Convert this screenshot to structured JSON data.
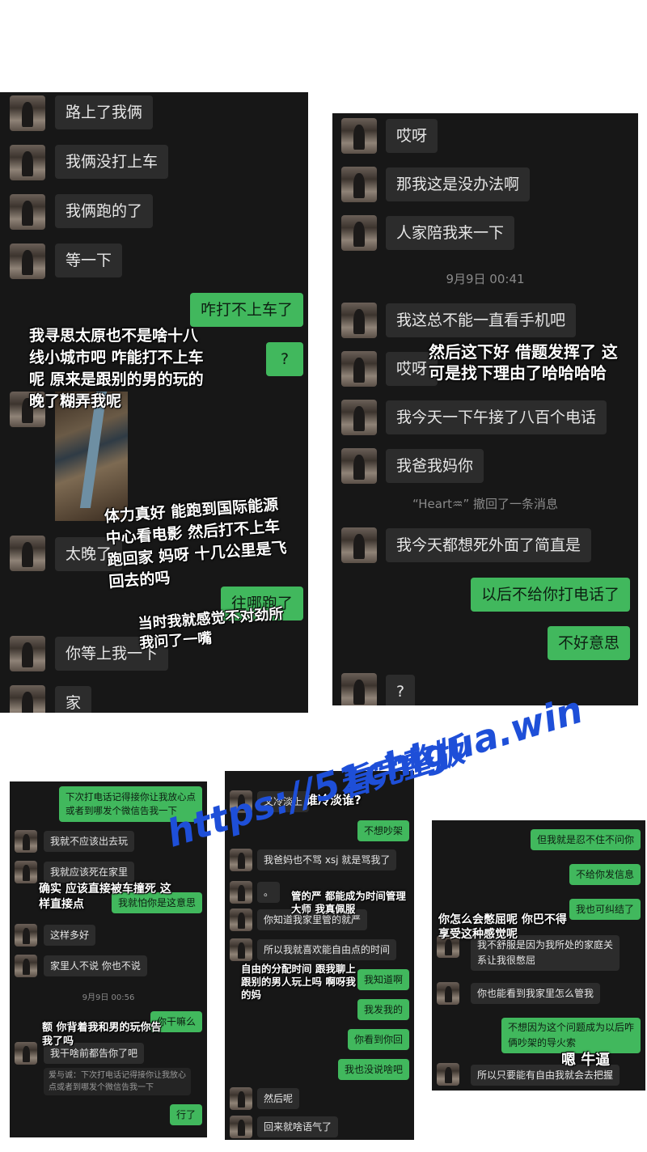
{
  "panel1": {
    "messages": [
      {
        "side": "left",
        "text": "路上了我俩"
      },
      {
        "side": "left",
        "text": "我俩没打上车"
      },
      {
        "side": "left",
        "text": "我俩跑的了"
      },
      {
        "side": "left",
        "text": "等一下"
      },
      {
        "side": "right",
        "text": "咋打不上车了"
      },
      {
        "side": "right",
        "text": "?"
      },
      {
        "side": "left",
        "text": "太晚了"
      },
      {
        "side": "right",
        "text": "往哪跑了"
      },
      {
        "side": "left",
        "text": "你等上我一下"
      },
      {
        "side": "left",
        "text": "家"
      }
    ],
    "captions": [
      "我寻思太原也不是啥十八\n线小城市吧 咋能打不上车\n呢 原来是跟别的男的玩的\n晚了糊弄我呢",
      "体力真好 能跑到国际能源\n中心看电影 然后打不上车\n跑回家 妈呀 十几公里是飞\n回去的吗",
      "当时我就感觉不对劲所\n我问了一嘴"
    ]
  },
  "panel2": {
    "messages": [
      {
        "side": "left",
        "text": "哎呀"
      },
      {
        "side": "left",
        "text": "那我这是没办法啊"
      },
      {
        "side": "left",
        "text": "人家陪我来一下"
      },
      {
        "side": "left",
        "text": "我这总不能一直看手机吧"
      },
      {
        "side": "left",
        "text": "哎呀"
      },
      {
        "side": "left",
        "text": "我今天一下午接了八百个电话"
      },
      {
        "side": "left",
        "text": "我爸我妈你"
      },
      {
        "side": "left",
        "text": "我今天都想死外面了简直是"
      },
      {
        "side": "right",
        "text": "以后不给你打电话了"
      },
      {
        "side": "right",
        "text": "不好意思"
      },
      {
        "side": "left",
        "text": "?"
      }
    ],
    "timestamp": "9月9日 00:41",
    "recall_notice": "“Heart♒” 撤回了一条消息",
    "caption": "然后这下好 借题发挥了 这\n可是找下理由了哈哈哈哈"
  },
  "panel3": {
    "messages": [
      {
        "side": "right",
        "text": "下次打电话记得接你让我放心点\n或者到哪发个微信告我一下"
      },
      {
        "side": "left",
        "text": "我就不应该出去玩"
      },
      {
        "side": "left",
        "text": "我就应该死在家里"
      },
      {
        "side": "right",
        "text": "我就怕你是这意思"
      },
      {
        "side": "left",
        "text": "这样多好"
      },
      {
        "side": "left",
        "text": "家里人不说 你也不说"
      },
      {
        "side": "right",
        "text": "你干嘛么"
      },
      {
        "side": "left",
        "text": "我干啥前都告你了吧"
      },
      {
        "side": "right",
        "text": "行了"
      }
    ],
    "timestamp": "9月9日 00:56",
    "quote": "爱与诚：下次打电话记得接你让我放心\n点或者到哪发个微信告我一下",
    "captions": [
      "确实 应该直接被车撞死 这\n样直接点",
      "额 你背着我和男的玩你告\n我了吗"
    ]
  },
  "panel4": {
    "messages": [
      {
        "side": "left",
        "text": "又冷淡上"
      },
      {
        "side": "right",
        "text": "不想吵架"
      },
      {
        "side": "left",
        "text": "我爸妈也不骂 xsj 就是骂我了"
      },
      {
        "side": "left",
        "text": "。"
      },
      {
        "side": "left",
        "text": "你知道我家里管的就严"
      },
      {
        "side": "left",
        "text": "所以我就喜欢能自由点的时间"
      },
      {
        "side": "right",
        "text": "我知道啊"
      },
      {
        "side": "right",
        "text": "我发我的"
      },
      {
        "side": "right",
        "text": "你看到你回"
      },
      {
        "side": "right",
        "text": "我也没说啥吧"
      },
      {
        "side": "left",
        "text": "然后呢"
      },
      {
        "side": "left",
        "text": "回来就啥语气了"
      }
    ],
    "captions": [
      "谁冷淡谁?",
      "管的严 都能成为时间管理\n大师 我真佩服",
      "自由的分配时间 跟我聊上\n跟别的男人玩上吗 啊呀我\n的妈"
    ]
  },
  "panel5": {
    "messages": [
      {
        "side": "right",
        "text": "但我就是忍不住不问你"
      },
      {
        "side": "right",
        "text": "不给你发信息"
      },
      {
        "side": "right",
        "text": "我也可纠结了"
      },
      {
        "side": "left",
        "text": "我不舒服是因为我所处的家庭关\n系让我很憋屈"
      },
      {
        "side": "left",
        "text": "你也能看到我家里怎么管我"
      },
      {
        "side": "right",
        "text": "不想因为这个问题成为以后咋\n俩吵架的导火索"
      },
      {
        "side": "left",
        "text": "所以只要能有自由我就会去把握"
      }
    ],
    "captions": [
      "你怎么会憋屈呢 你巴不得\n享受这种感觉呢",
      "嗯 牛逼"
    ]
  },
  "watermark": {
    "line1": "https://51chigua.win",
    "line2": "看完整版"
  }
}
